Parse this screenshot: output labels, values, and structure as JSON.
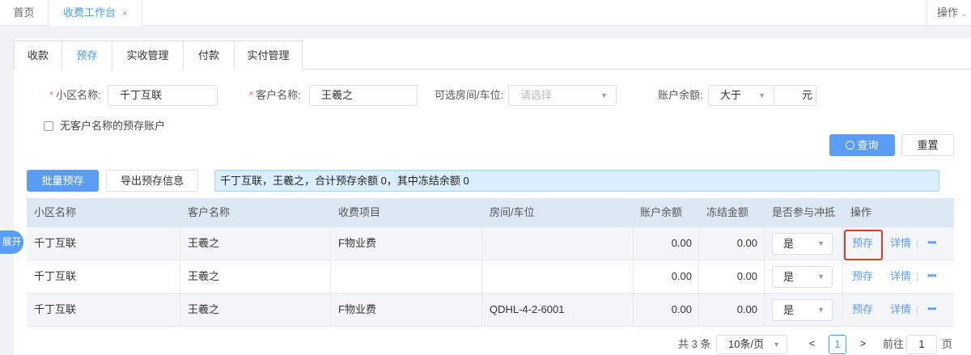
{
  "topbar": {
    "home_label": "首页",
    "active_tab_label": "收费工作台",
    "close_glyph": "×",
    "ops_label": "操作",
    "ops_chevron": "⌄"
  },
  "subtabs": [
    "收款",
    "预存",
    "实收管理",
    "付款",
    "实付管理"
  ],
  "active_subtab": "预存",
  "filters": {
    "community_label": "小区名称:",
    "community_value": "千丁互联",
    "customer_label": "客户名称:",
    "customer_value": "王羲之",
    "room_label": "可选房间/车位:",
    "room_placeholder": "请选择",
    "balance_label": "账户余额:",
    "balance_op": "大于",
    "balance_unit": "元",
    "no_customer_checkbox": "无客户名称的预存账户",
    "required_mark": "*"
  },
  "buttons": {
    "query": "查询",
    "reset": "重置",
    "batch_prestore": "批量预存",
    "export": "导出预存信息"
  },
  "info_text": "千丁互联，王羲之，合计预存余额 0，其中冻结余额 0",
  "table": {
    "headers": [
      "小区名称",
      "客户名称",
      "收费项目",
      "房间/车位",
      "账户余额",
      "冻结金额",
      "是否参与冲抵",
      "操作"
    ],
    "rows": [
      {
        "community": "千丁互联",
        "customer": "王羲之",
        "item": "F物业费",
        "room": "",
        "balance": "0.00",
        "frozen": "0.00",
        "offset": "是"
      },
      {
        "community": "千丁互联",
        "customer": "王羲之",
        "item": "",
        "room": "",
        "balance": "0.00",
        "frozen": "0.00",
        "offset": "是"
      },
      {
        "community": "千丁互联",
        "customer": "王羲之",
        "item": "F物业费",
        "room": "QDHL-4-2-6001",
        "balance": "0.00",
        "frozen": "0.00",
        "offset": "是"
      }
    ],
    "action_prestore": "预存",
    "action_detail": "详情",
    "action_more": "•••"
  },
  "expand_label": "展开",
  "pagination": {
    "total": "共 3 条",
    "page_size": "10条/页",
    "prev": "<",
    "current": "1",
    "next": ">",
    "goto_label": "前往",
    "goto_value": "1",
    "page_suffix": "页"
  },
  "colors": {
    "primary": "#5b9df5",
    "highlight_border": "#e0392b",
    "info_bg": "#dbeeff"
  }
}
